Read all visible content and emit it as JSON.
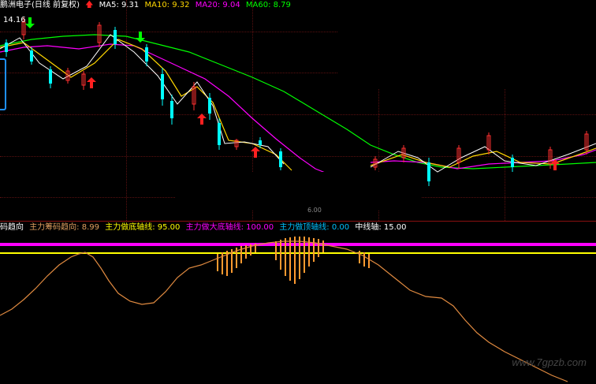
{
  "main_chart": {
    "title": "鹏洲电子(日线 前复权)",
    "ma_legend": [
      {
        "label": "MA5: 9.31",
        "color": "#ffffff"
      },
      {
        "label": "MA10: 9.32",
        "color": "#ffd700"
      },
      {
        "label": "MA20: 9.04",
        "color": "#ff00ff"
      },
      {
        "label": "MA60: 8.79",
        "color": "#00ff00"
      }
    ],
    "high_price_label": "14.16",
    "low_price_label": "6.00"
  },
  "indicator": {
    "name": "码趋向",
    "legend": [
      {
        "label": "主力筹码趋向: 8.99",
        "color": "#e0a060"
      },
      {
        "label": "主力做底轴线: 95.00",
        "color": "#ffff00"
      },
      {
        "label": "主力做大底轴线: 100.00",
        "color": "#ff00ff"
      },
      {
        "label": "主力做顶轴线: 0.00",
        "color": "#00c0ff"
      },
      {
        "label": "中线轴: 15.00",
        "color": "#ffffff"
      }
    ]
  },
  "watermark": "www.7gpzb.com"
}
